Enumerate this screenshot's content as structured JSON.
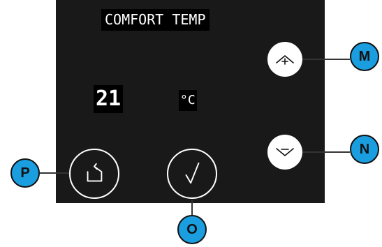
{
  "screen": {
    "title": "COMFORT TEMP",
    "temperature_value": "21",
    "temperature_unit": "°C"
  },
  "buttons": {
    "up": {
      "icon": "chevron-up-plus-icon"
    },
    "down": {
      "icon": "chevron-down-minus-icon"
    },
    "back": {
      "icon": "return-arrow-icon"
    },
    "confirm": {
      "icon": "checkmark-icon"
    }
  },
  "callouts": {
    "m": "M",
    "n": "N",
    "o": "O",
    "p": "P"
  },
  "colors": {
    "screen_background": "#191919",
    "callout_fill": "#1a9ee0",
    "button_fill": "#ffffff"
  }
}
